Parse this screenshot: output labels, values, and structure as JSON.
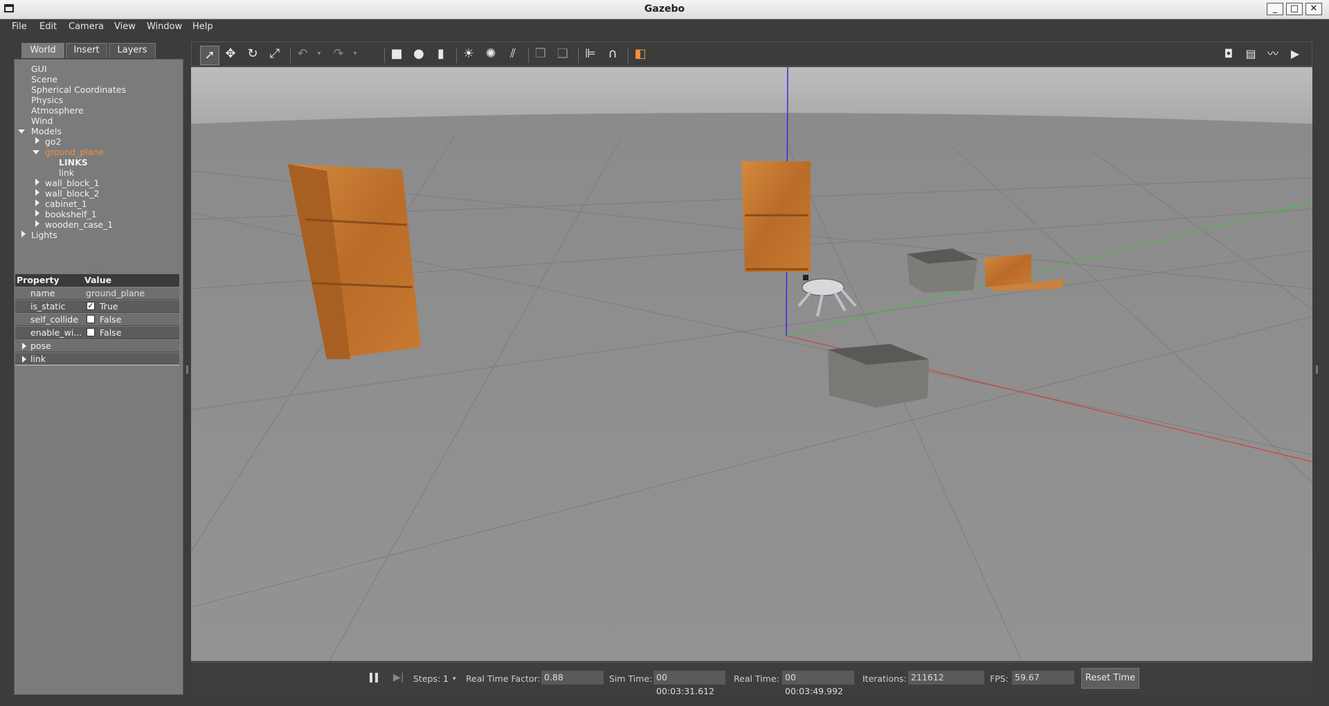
{
  "window": {
    "title": "Gazebo"
  },
  "menu": [
    "File",
    "Edit",
    "Camera",
    "View",
    "Window",
    "Help"
  ],
  "tabs": [
    "World",
    "Insert",
    "Layers"
  ],
  "tree": {
    "items": [
      "GUI",
      "Scene",
      "Spherical Coordinates",
      "Physics",
      "Atmosphere",
      "Wind"
    ],
    "models_label": "Models",
    "models": [
      "go2",
      "ground_plane",
      "wall_block_1",
      "wall_block_2",
      "cabinet_1",
      "bookshelf_1",
      "wooden_case_1"
    ],
    "links_header": "LINKS",
    "link_child": "link",
    "lights_label": "Lights"
  },
  "properties": {
    "header_property": "Property",
    "header_value": "Value",
    "rows": [
      {
        "key": "name",
        "value": "ground_plane"
      },
      {
        "key": "is_static",
        "value": "True",
        "checked": true
      },
      {
        "key": "self_collide",
        "value": "False",
        "checked": false
      },
      {
        "key": "enable_wi...",
        "value": "False",
        "checked": false
      }
    ],
    "groups": [
      "pose",
      "link"
    ]
  },
  "toolbar": {
    "tools": [
      "select-icon",
      "translate-icon",
      "rotate-icon",
      "scale-icon",
      "undo-icon",
      "redo-icon",
      "box-icon",
      "sphere-icon",
      "cylinder-icon",
      "point-light-icon",
      "spot-light-icon",
      "directional-light-icon",
      "copy-icon",
      "paste-icon",
      "align-icon",
      "snap-icon",
      "view-angle-icon",
      "screenshot-icon",
      "log-icon",
      "plot-icon",
      "record-icon"
    ]
  },
  "bottom": {
    "steps_label": "Steps:",
    "steps_value": "1",
    "rtf_label": "Real Time Factor:",
    "rtf_value": "0.88",
    "sim_label": "Sim Time:",
    "sim_value": "00 00:03:31.612",
    "real_label": "Real Time:",
    "real_value": "00 00:03:49.992",
    "iter_label": "Iterations:",
    "iter_value": "211612",
    "fps_label": "FPS:",
    "fps_value": "59.67",
    "reset_label": "Reset Time"
  },
  "colors": {
    "accent": "#f58f3a",
    "ground": "#8e8e8e",
    "sky": "#b5b5b5",
    "wood": "#c97b33",
    "axis_x": "#d04040",
    "axis_y": "#3fbf3f",
    "axis_z": "#3030e0"
  }
}
